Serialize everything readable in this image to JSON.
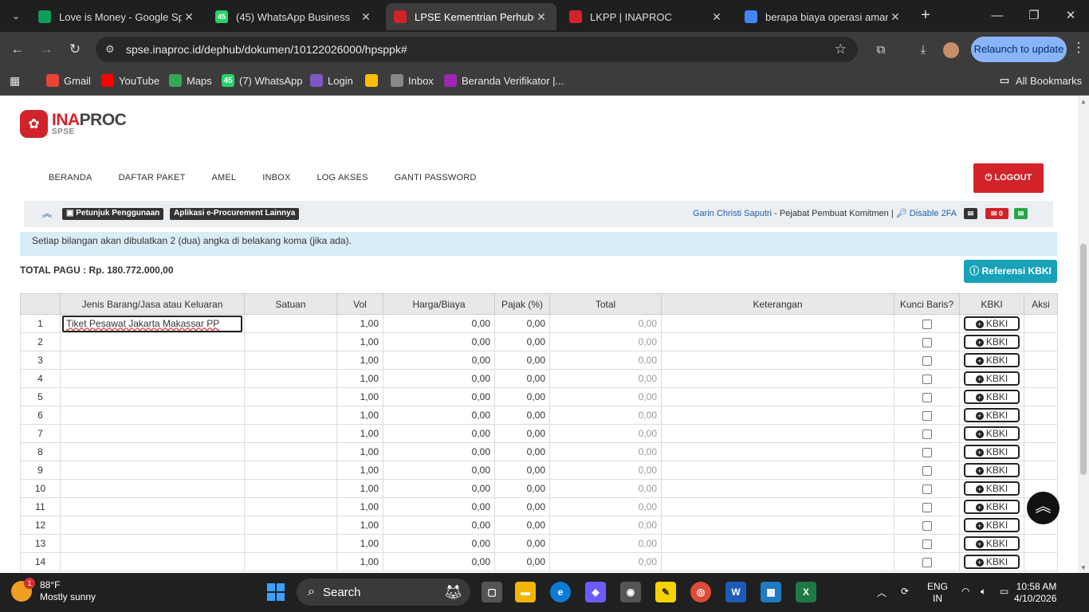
{
  "browser": {
    "tabs": [
      {
        "title": "Love is Money - Google Spre",
        "icon": "sheets-icon",
        "color": "#0f9d58"
      },
      {
        "title": "(45) WhatsApp Business",
        "icon": "whatsapp-icon",
        "color": "#25d366",
        "badge": "45"
      },
      {
        "title": "LPSE Kementrian Perhubung",
        "icon": "lpse-icon",
        "color": "#d2232a"
      },
      {
        "title": "LKPP | INAPROC",
        "icon": "lkpp-icon",
        "color": "#d2232a"
      },
      {
        "title": "berapa biaya operasi amand",
        "icon": "google-icon",
        "color": "#4285f4"
      }
    ],
    "url": "spse.inaproc.id/dephub/dokumen/10122026000/hpsppk#",
    "relaunch_label": "Relaunch to update",
    "bookmarks": [
      {
        "label": "Gmail",
        "icon": "gmail-icon",
        "color": "#ea4335"
      },
      {
        "label": "YouTube",
        "icon": "youtube-icon",
        "color": "#ff0000"
      },
      {
        "label": "Maps",
        "icon": "maps-icon",
        "color": "#34a853"
      },
      {
        "label": "(7) WhatsApp",
        "icon": "whatsapp-icon",
        "color": "#25d366",
        "badge": "45"
      },
      {
        "label": "Login",
        "icon": "login-icon",
        "color": "#7e57c2"
      },
      {
        "label": "",
        "icon": "photos-icon",
        "color": "#fbbc05"
      },
      {
        "label": "Inbox",
        "icon": "mail-icon",
        "color": "#888888"
      },
      {
        "label": "Beranda Verifikator |...",
        "icon": "verifikator-icon",
        "color": "#9c27b0"
      }
    ],
    "all_bookmarks": "All Bookmarks"
  },
  "site": {
    "brand_a": "INA",
    "brand_b": "PROC",
    "brand_sub": "SPSE",
    "nav": [
      "BERANDA",
      "DAFTAR PAKET",
      "AMEL",
      "INBOX",
      "LOG AKSES",
      "GANTI PASSWORD"
    ],
    "logout": "LOGOUT",
    "petunjuk": "Petunjuk Penggunaan",
    "aplikasi": "Aplikasi e-Procurement Lainnya",
    "user_name": "Garin Christi Saputri",
    "user_role": " - Pejabat Pembuat Komitmen | ",
    "disable_2fa": "Disable 2FA",
    "mail_count": "0"
  },
  "content": {
    "info_text": "Setiap bilangan akan dibulatkan 2 (dua) angka di belakang koma (jika ada).",
    "total_pagu": "TOTAL PAGU : Rp. 180.772.000,00",
    "ref_button": "Referensi KBKI",
    "columns": [
      "",
      "Jenis Barang/Jasa atau Keluaran",
      "Satuan",
      "Vol",
      "Harga/Biaya",
      "Pajak (%)",
      "Total",
      "Keterangan",
      "Kunci Baris?",
      "KBKI",
      "Aksi"
    ],
    "kbki_label": "KBKI",
    "rows": [
      {
        "no": "1",
        "item": "Tiket Pesawat Jakarta Makassar PP",
        "satuan": "",
        "vol": "1,00",
        "harga": "0,00",
        "pajak": "0,00",
        "total": "0,00",
        "ket": ""
      },
      {
        "no": "2",
        "item": "",
        "satuan": "",
        "vol": "1,00",
        "harga": "0,00",
        "pajak": "0,00",
        "total": "0,00",
        "ket": ""
      },
      {
        "no": "3",
        "item": "",
        "satuan": "",
        "vol": "1,00",
        "harga": "0,00",
        "pajak": "0,00",
        "total": "0,00",
        "ket": ""
      },
      {
        "no": "4",
        "item": "",
        "satuan": "",
        "vol": "1,00",
        "harga": "0,00",
        "pajak": "0,00",
        "total": "0,00",
        "ket": ""
      },
      {
        "no": "5",
        "item": "",
        "satuan": "",
        "vol": "1,00",
        "harga": "0,00",
        "pajak": "0,00",
        "total": "0,00",
        "ket": ""
      },
      {
        "no": "6",
        "item": "",
        "satuan": "",
        "vol": "1,00",
        "harga": "0,00",
        "pajak": "0,00",
        "total": "0,00",
        "ket": ""
      },
      {
        "no": "7",
        "item": "",
        "satuan": "",
        "vol": "1,00",
        "harga": "0,00",
        "pajak": "0,00",
        "total": "0,00",
        "ket": ""
      },
      {
        "no": "8",
        "item": "",
        "satuan": "",
        "vol": "1,00",
        "harga": "0,00",
        "pajak": "0,00",
        "total": "0,00",
        "ket": ""
      },
      {
        "no": "9",
        "item": "",
        "satuan": "",
        "vol": "1,00",
        "harga": "0,00",
        "pajak": "0,00",
        "total": "0,00",
        "ket": ""
      },
      {
        "no": "10",
        "item": "",
        "satuan": "",
        "vol": "1,00",
        "harga": "0,00",
        "pajak": "0,00",
        "total": "0,00",
        "ket": ""
      },
      {
        "no": "11",
        "item": "",
        "satuan": "",
        "vol": "1,00",
        "harga": "0,00",
        "pajak": "0,00",
        "total": "0,00",
        "ket": ""
      },
      {
        "no": "12",
        "item": "",
        "satuan": "",
        "vol": "1,00",
        "harga": "0,00",
        "pajak": "0,00",
        "total": "0,00",
        "ket": ""
      },
      {
        "no": "13",
        "item": "",
        "satuan": "",
        "vol": "1,00",
        "harga": "0,00",
        "pajak": "0,00",
        "total": "0,00",
        "ket": ""
      },
      {
        "no": "14",
        "item": "",
        "satuan": "",
        "vol": "1,00",
        "harga": "0,00",
        "pajak": "0,00",
        "total": "0,00",
        "ket": ""
      }
    ]
  },
  "taskbar": {
    "temp": "88°F",
    "condition": "Mostly sunny",
    "weather_badge": "1",
    "search_label": "Search",
    "lang_a": "ENG",
    "lang_b": "IN",
    "time": "10:58 AM",
    "date": "4/10/2026"
  }
}
